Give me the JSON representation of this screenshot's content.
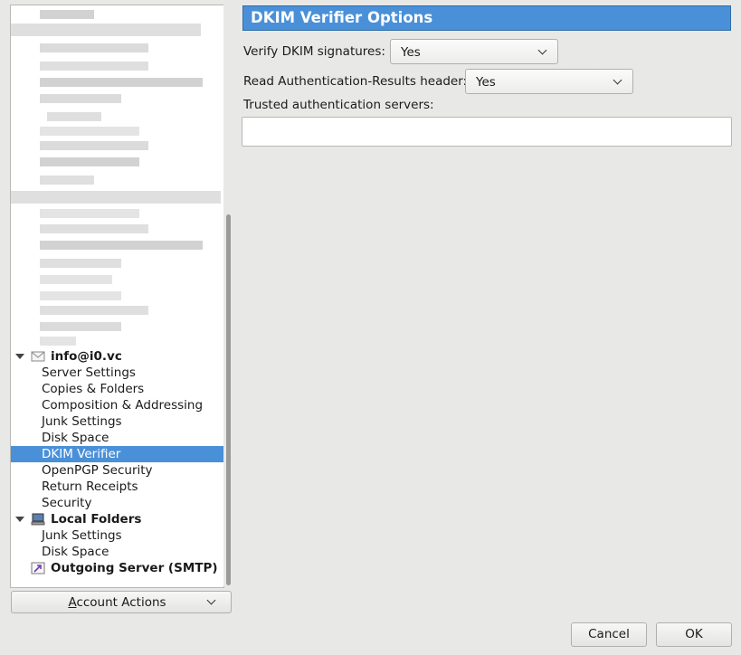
{
  "tree": {
    "account_name": "info@i0.vc",
    "account_items": [
      "Server Settings",
      "Copies & Folders",
      "Composition & Addressing",
      "Junk Settings",
      "Disk Space",
      "DKIM Verifier",
      "OpenPGP Security",
      "Return Receipts",
      "Security"
    ],
    "selected_item": "DKIM Verifier",
    "local_folders": "Local Folders",
    "local_items": [
      "Junk Settings",
      "Disk Space"
    ],
    "outgoing_server": "Outgoing Server (SMTP)"
  },
  "account_actions": {
    "label_prefix": "A",
    "label_rest": "ccount Actions"
  },
  "options": {
    "title": "DKIM Verifier Options",
    "verify_label": "Verify DKIM signatures:",
    "verify_value": "Yes",
    "read_auth_label": "Read Authentication-Results header:",
    "read_auth_value": "Yes",
    "trusted_label": "Trusted authentication servers:",
    "trusted_value": ""
  },
  "buttons": {
    "cancel": "Cancel",
    "ok": "OK"
  },
  "colors": {
    "accent": "#4a90d9",
    "background": "#e8e8e7"
  }
}
